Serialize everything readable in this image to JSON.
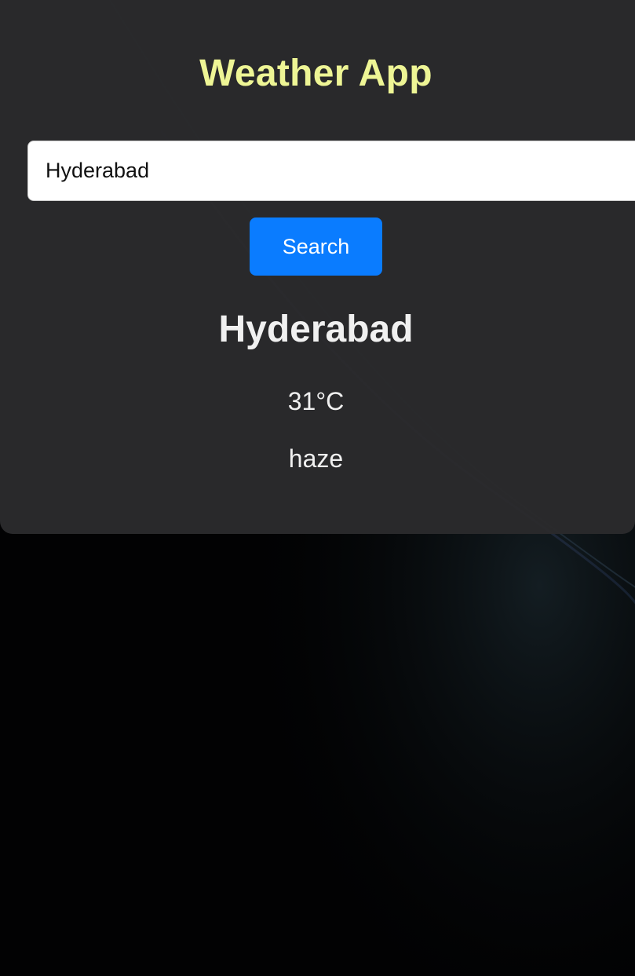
{
  "app": {
    "title": "Weather App"
  },
  "search": {
    "value": "Hyderabad",
    "button_label": "Search"
  },
  "result": {
    "city": "Hyderabad",
    "temperature": "31°C",
    "description": "haze"
  },
  "colors": {
    "title": "#eef595",
    "button": "#0a7cff",
    "card": "#2a2a2c",
    "background": "#000000"
  }
}
